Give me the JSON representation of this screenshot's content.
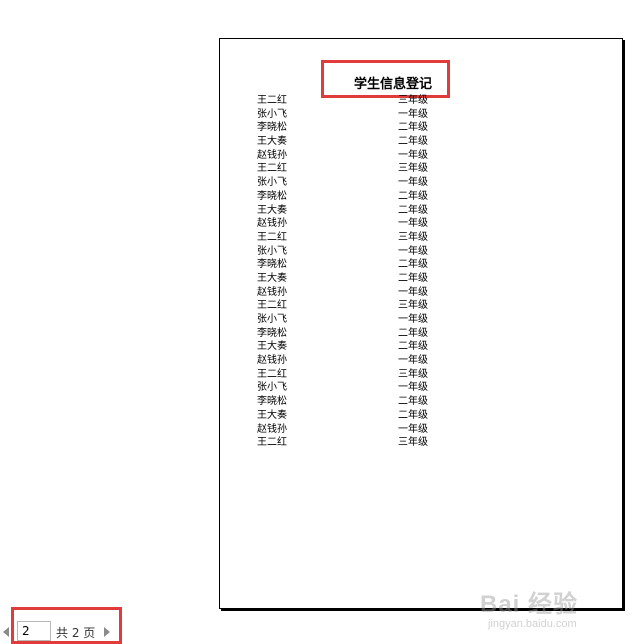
{
  "document": {
    "title": "学生信息登记",
    "rows": [
      {
        "name": "王二红",
        "grade": "三年级"
      },
      {
        "name": "张小飞",
        "grade": "一年级"
      },
      {
        "name": "李晓松",
        "grade": "二年级"
      },
      {
        "name": "王大奏",
        "grade": "二年级"
      },
      {
        "name": "赵钱孙",
        "grade": "一年级"
      },
      {
        "name": "王二红",
        "grade": "三年级"
      },
      {
        "name": "张小飞",
        "grade": "一年级"
      },
      {
        "name": "李晓松",
        "grade": "二年级"
      },
      {
        "name": "王大奏",
        "grade": "二年级"
      },
      {
        "name": "赵钱孙",
        "grade": "一年级"
      },
      {
        "name": "王二红",
        "grade": "三年级"
      },
      {
        "name": "张小飞",
        "grade": "一年级"
      },
      {
        "name": "李晓松",
        "grade": "二年级"
      },
      {
        "name": "王大奏",
        "grade": "二年级"
      },
      {
        "name": "赵钱孙",
        "grade": "一年级"
      },
      {
        "name": "王二红",
        "grade": "三年级"
      },
      {
        "name": "张小飞",
        "grade": "一年级"
      },
      {
        "name": "李晓松",
        "grade": "二年级"
      },
      {
        "name": "王大奏",
        "grade": "二年级"
      },
      {
        "name": "赵钱孙",
        "grade": "一年级"
      },
      {
        "name": "王二红",
        "grade": "三年级"
      },
      {
        "name": "张小飞",
        "grade": "一年级"
      },
      {
        "name": "李晓松",
        "grade": "二年级"
      },
      {
        "name": "王大奏",
        "grade": "二年级"
      },
      {
        "name": "赵钱孙",
        "grade": "一年级"
      },
      {
        "name": "王二红",
        "grade": "三年级"
      }
    ]
  },
  "pager": {
    "current_page": "2",
    "total_label": "共 2 页"
  },
  "watermark": {
    "text": "Bai 经验",
    "url": "jingyan.baidu.com"
  },
  "colors": {
    "highlight": "#e23b3b",
    "page_border": "#000000"
  }
}
